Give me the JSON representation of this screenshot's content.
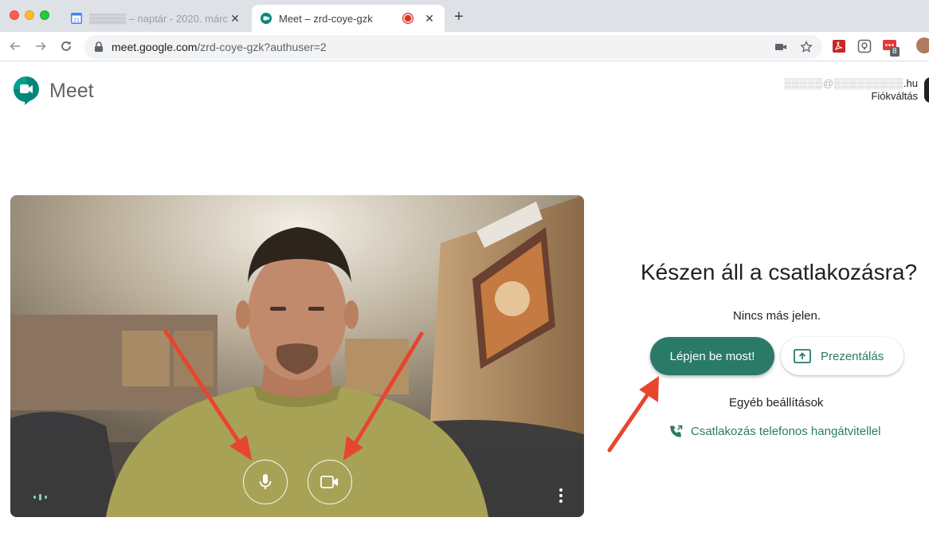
{
  "browser": {
    "tabs": [
      {
        "title": "▒▒▒▒▒ – naptár - 2020. márciu",
        "favicon": "calendar-icon",
        "favicon_text": "21",
        "active": false
      },
      {
        "title": "Meet – zrd-coye-gzk",
        "favicon": "meet-icon",
        "active": true,
        "recording": true
      }
    ],
    "url_host": "meet.google.com",
    "url_path": "/zrd-coye-gzk?authuser=2",
    "extension_badge": "8"
  },
  "meet": {
    "app_name": "Meet",
    "account_email_blurred": "▒▒▒▒▒@▒▒▒▒▒▒▒▒▒",
    "account_email_tld": ".hu",
    "account_switch": "Fiókváltás",
    "ready_title": "Készen áll a csatlakozásra?",
    "no_one_here": "Nincs más jelen.",
    "join_now": "Lépjen be most!",
    "present": "Prezentálás",
    "other_settings": "Egyéb beállítások",
    "phone_audio": "Csatlakozás telefonos hangátvitellel"
  },
  "colors": {
    "accent": "#2a7a68",
    "arrow": "#e8452f",
    "tabbar": "#dee1e6"
  }
}
